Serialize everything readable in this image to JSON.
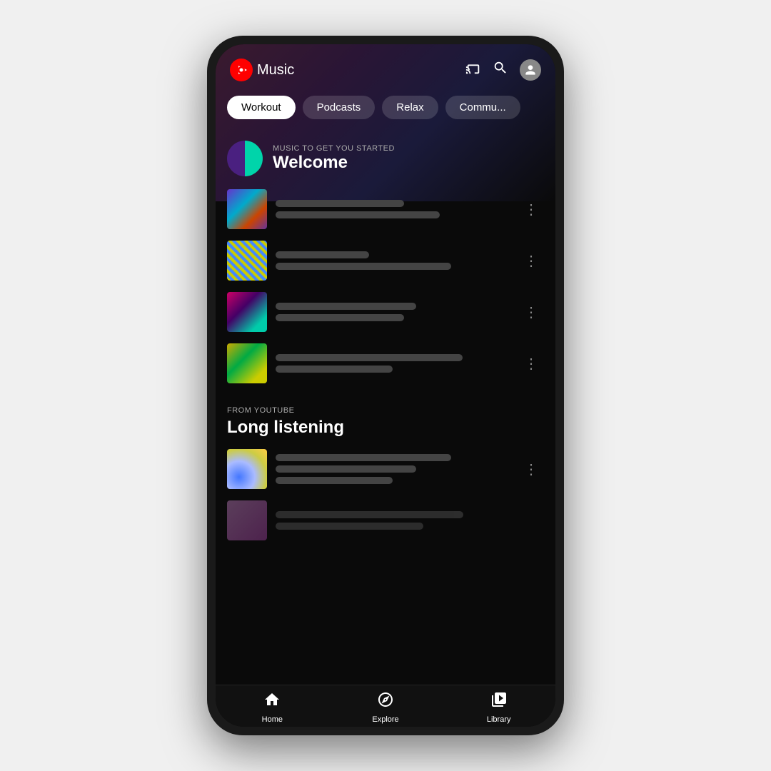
{
  "app": {
    "name": "Music",
    "logo_icon": "play-circle-icon"
  },
  "header": {
    "cast_icon": "cast-icon",
    "search_icon": "search-icon",
    "profile_icon": "profile-icon"
  },
  "chips": [
    {
      "label": "Workout",
      "active": true
    },
    {
      "label": "Podcasts",
      "active": false
    },
    {
      "label": "Relax",
      "active": false
    },
    {
      "label": "Commu...",
      "active": false
    }
  ],
  "sections": [
    {
      "id": "welcome",
      "subtitle": "MUSIC TO GET YOU STARTED",
      "title": "Welcome",
      "has_icon": true,
      "tracks": [
        {
          "id": 1,
          "line1_width": "55%",
          "line2_width": "70%"
        },
        {
          "id": 2,
          "line1_width": "40%",
          "line2_width": "75%"
        },
        {
          "id": 3,
          "line1_width": "60%",
          "line2_width": "55%"
        },
        {
          "id": 4,
          "line1_width": "80%",
          "line2_width": "50%"
        }
      ]
    },
    {
      "id": "long-listening",
      "subtitle": "FROM YOUTUBE",
      "title": "Long listening",
      "has_icon": false,
      "tracks": [
        {
          "id": 5,
          "line1_width": "75%",
          "line2_width": "60%",
          "line3_width": "50%"
        },
        {
          "id": 6,
          "line1_width": "70%",
          "line2_width": "55%"
        }
      ]
    }
  ],
  "bottom_nav": [
    {
      "label": "Home",
      "icon": "home-icon",
      "active": true
    },
    {
      "label": "Explore",
      "icon": "explore-icon",
      "active": false
    },
    {
      "label": "Library",
      "icon": "library-icon",
      "active": false
    }
  ],
  "more_icon_label": "⋮"
}
